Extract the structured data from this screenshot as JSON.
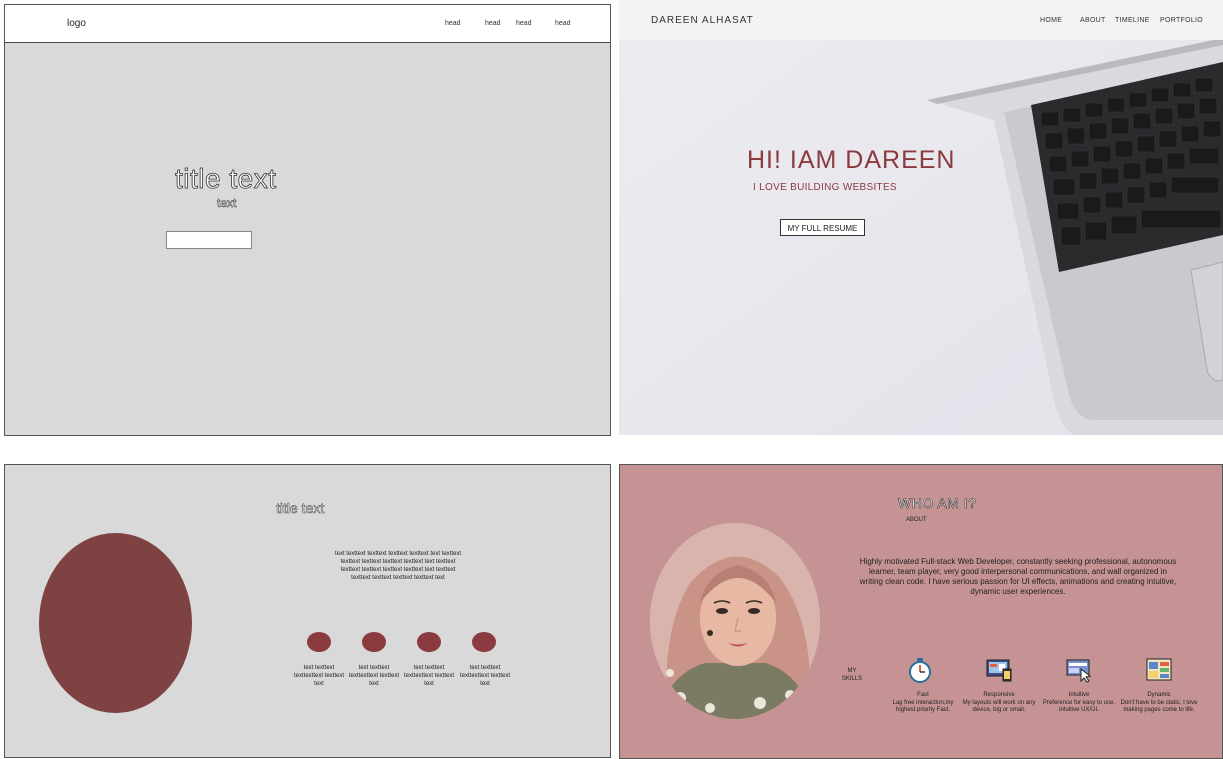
{
  "wireframe_hero": {
    "logo": "logo",
    "nav": [
      "head",
      "head",
      "head",
      "head"
    ],
    "title": "title text",
    "subtitle": "text"
  },
  "hero": {
    "brand": "DAREEN ALHASAT",
    "nav": [
      "HOME",
      "ABOUT",
      "TIMELINE",
      "PORTFOLIO"
    ],
    "headline": "HI! IAM DAREEN",
    "tagline": "I LOVE BUILDING WEBSITES",
    "resume_button": "MY FULL RESUME",
    "colors": {
      "accent": "#8b3a3f",
      "background": "#e9e9ee"
    }
  },
  "wireframe_about": {
    "title": "title text",
    "paragraph": "text texttext texttext texttext texttext text texttext texttext texttext texttext texttext text texttext texttext texttext texttext texttext text texttext texttext texttext texttext texttext text",
    "items": [
      "text texttext texttexttext texttext text",
      "text texttext texttexttext texttext text",
      "text texttext texttexttext texttext text",
      "text texttext texttexttext texttext text"
    ]
  },
  "about": {
    "title": "WHO AM I?",
    "label": "ABOUT",
    "bio": "Highly motivated Full-stack Web Developer, constantly seeking professional, autonomous learner, team player, very good interpersonal communications, and wall organized in writing clean code. I have serious passion for UI effects, animations and creating intuitive, dynamic user experiences.",
    "skills_label": "MY SKILLS",
    "skills": [
      {
        "title": "Fast",
        "desc": "Lag free interaction,my highest priority Fast.",
        "icon": "stopwatch-icon"
      },
      {
        "title": "Responsive",
        "desc": "My layouts will work on any device, big or small.",
        "icon": "devices-icon"
      },
      {
        "title": "Intuitive",
        "desc": "Preference for easy to use, intuitive UX/UI.",
        "icon": "cursor-screen-icon"
      },
      {
        "title": "Dynamic",
        "desc": "Don't have to be static, I love making pages come to life.",
        "icon": "dashboard-icon"
      }
    ],
    "colors": {
      "background": "#c69394"
    }
  }
}
